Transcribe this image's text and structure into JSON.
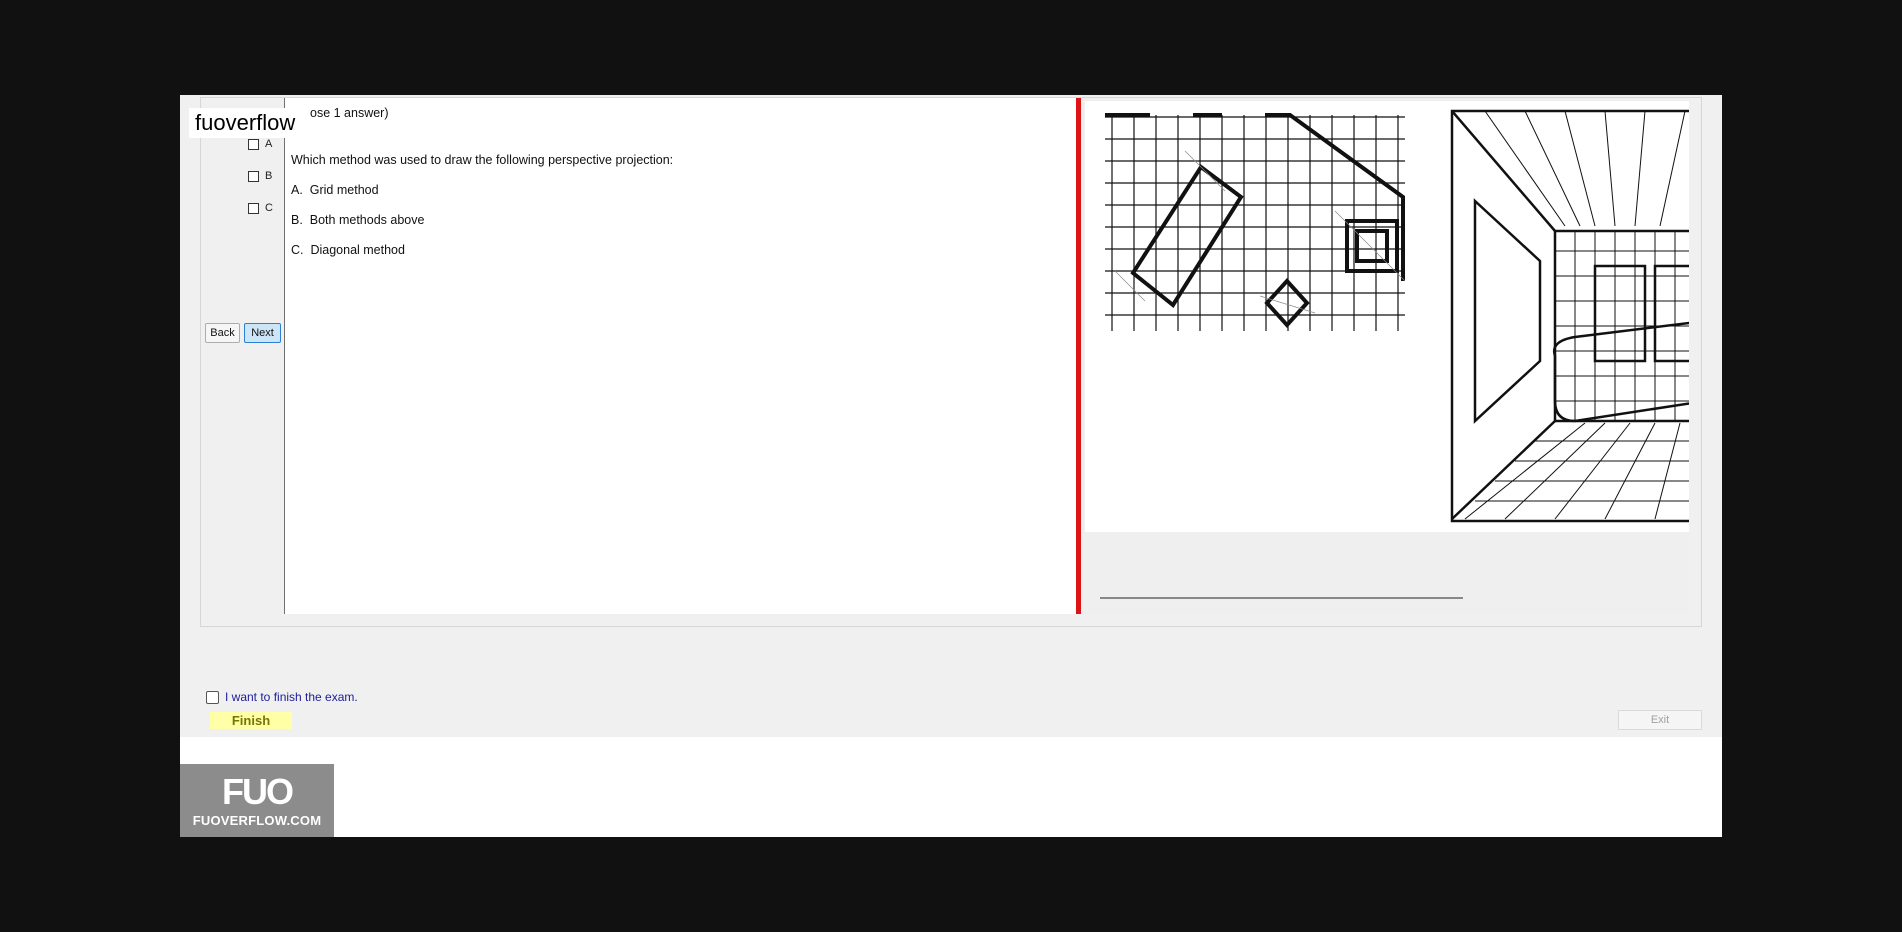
{
  "question": {
    "header": "(Choose 1 answer)",
    "header_visible": "ose 1 answer)",
    "prompt": "Which method was used to draw the following perspective projection:",
    "options": [
      {
        "letter": "A.",
        "text": "Grid method"
      },
      {
        "letter": "B.",
        "text": "Both methods above"
      },
      {
        "letter": "C.",
        "text": "Diagonal method"
      }
    ]
  },
  "answers": [
    {
      "label": "A"
    },
    {
      "label": "B"
    },
    {
      "label": "C"
    }
  ],
  "nav": {
    "back_label": "Back",
    "next_label": "Next"
  },
  "watermark": {
    "text": "fuoverflow"
  },
  "finish": {
    "checkbox_label": "I want to finish the exam.",
    "button_label": "Finish"
  },
  "exit": {
    "label": "Exit"
  },
  "logo": {
    "mark": "FUO",
    "sub": "FUOVERFLOW.COM"
  },
  "colors": {
    "splitter": "#dd1414",
    "finish_bg": "#ffffa8",
    "next_bg": "#cde6f7"
  }
}
